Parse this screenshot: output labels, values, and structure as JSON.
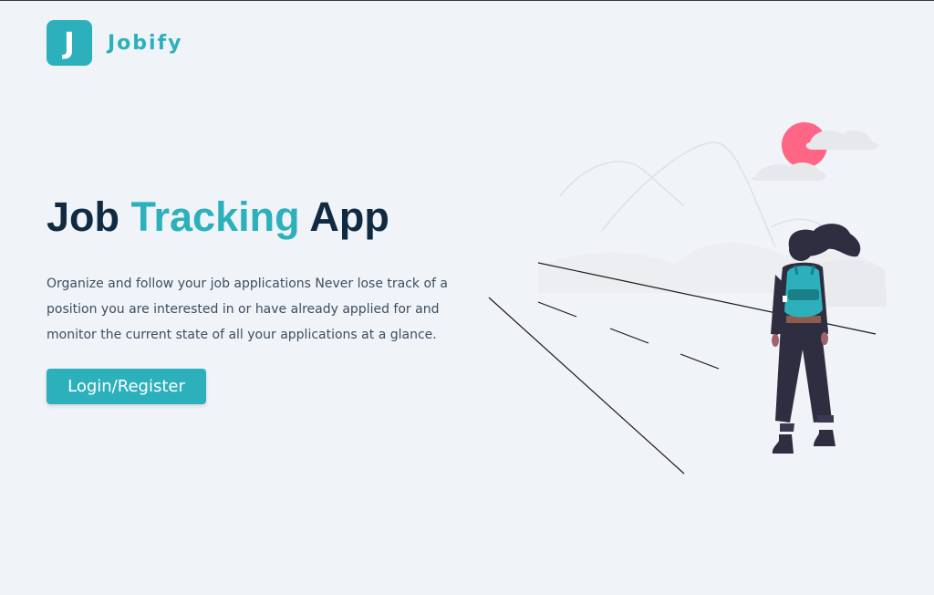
{
  "header": {
    "logo_letter": "J",
    "brand_name": "Jobify"
  },
  "hero": {
    "title_part1": "Job ",
    "title_accent": "Tracking",
    "title_part2": " App",
    "description": "Organize and follow your job applications Never lose track of a position you are interested in or have already applied for and monitor the current state of all your applications at a glance.",
    "cta_label": "Login/Register"
  },
  "colors": {
    "primary": "#2cb1bc",
    "heading": "#102a42",
    "text": "#3d4e60",
    "background": "#f0f3f8",
    "sun": "#ff6584",
    "figure_dark": "#2f2e41"
  },
  "illustration": {
    "name": "hiker-looking-at-mountains"
  }
}
